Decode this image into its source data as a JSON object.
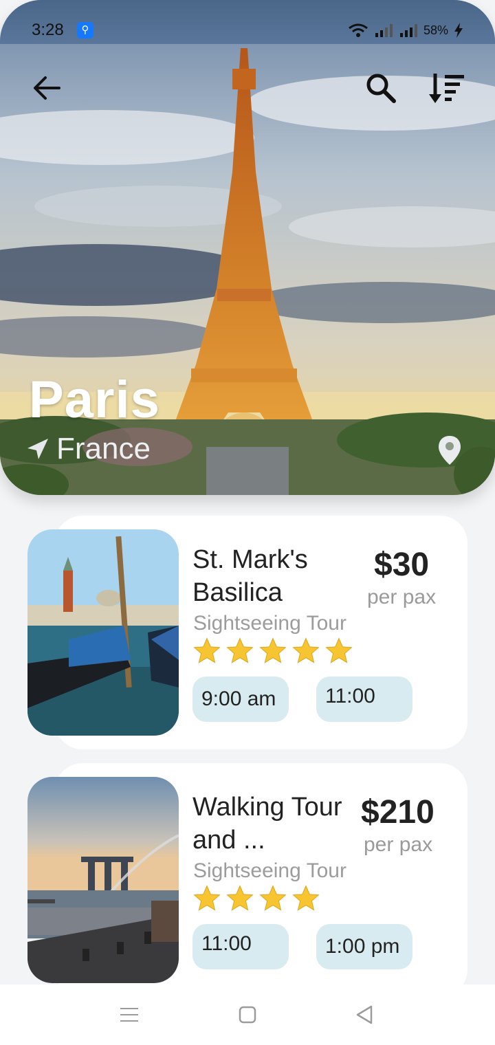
{
  "status_bar": {
    "time": "3:28",
    "battery": "58%"
  },
  "destination": {
    "city": "Paris",
    "country": "France"
  },
  "icons": {
    "back": "arrow-left-icon",
    "search": "search-icon",
    "sort": "sort-icon",
    "location": "map-pin-icon",
    "navigation": "navigation-arrow-icon"
  },
  "tours": [
    {
      "title_line1": "St. Mark's",
      "title_line2": "Basilica",
      "price": "$30",
      "price_unit": "per pax",
      "type": "Sightseeing Tour",
      "rating": 5,
      "times": [
        "9:00 am",
        "11:00"
      ]
    },
    {
      "title_line1": "Walking Tour",
      "title_line2": "and ...",
      "price": "$210",
      "price_unit": "per pax",
      "type": "Sightseeing Tour",
      "rating": 4,
      "times": [
        "11:00",
        "1:00 pm"
      ]
    }
  ],
  "colors": {
    "chip_bg": "#d8ebf1",
    "star": "#f7c531",
    "background": "#f3f4f6"
  }
}
